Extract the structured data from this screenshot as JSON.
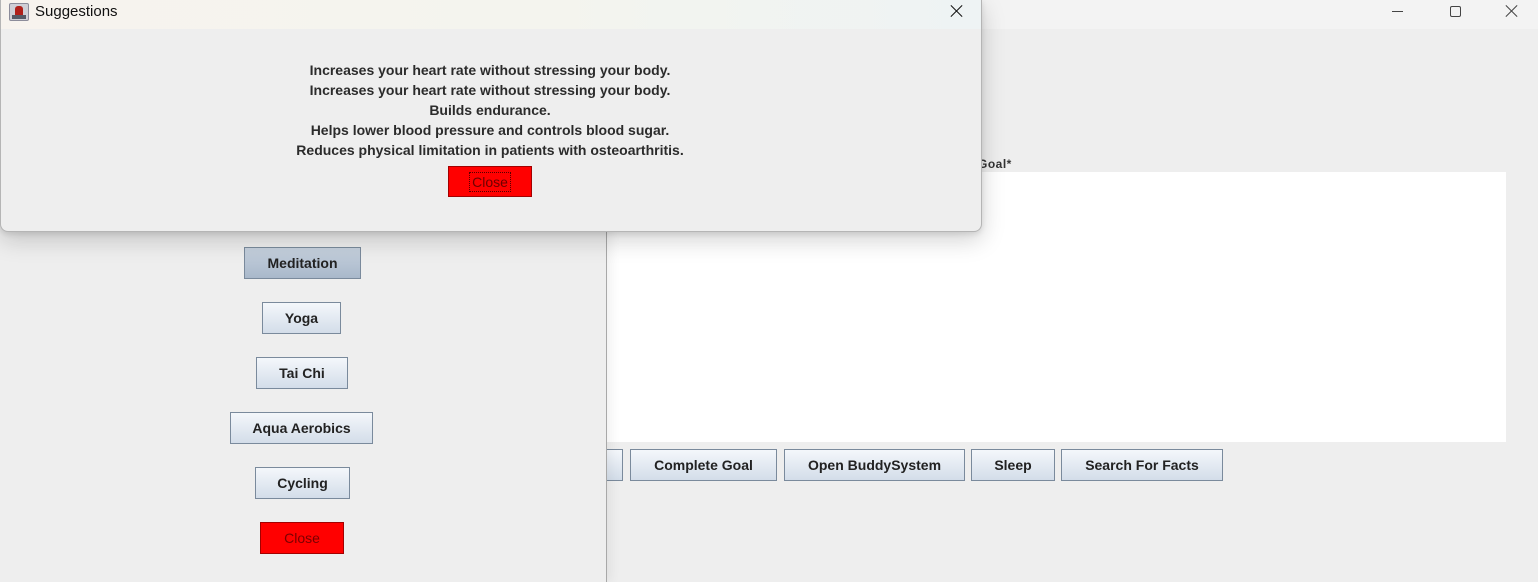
{
  "main_window": {
    "goal_label": "Goal*",
    "buttons": {
      "complete_goal": "Complete Goal",
      "open_buddy_system": "Open BuddySystem",
      "sleep": "Sleep",
      "search_for_facts": "Search For Facts"
    }
  },
  "activities_panel": {
    "buttons": [
      "Meditation",
      "Yoga",
      "Tai Chi",
      "Aqua Aerobics",
      "Cycling"
    ],
    "close_label": "Close"
  },
  "dialog": {
    "title": "Suggestions",
    "lines": [
      "Increases your heart rate without stressing your body.",
      "Increases your heart rate without stressing your body.",
      "Builds endurance.",
      "Helps lower blood pressure and controls blood sugar.",
      "Reduces physical limitation in patients with osteoarthritis."
    ],
    "close_label": "Close"
  },
  "colors": {
    "close_button": "#ff0000",
    "background": "#eeeeee",
    "text_area": "#ffffff"
  },
  "icons": [
    "app-icon",
    "minimize-icon",
    "maximize-icon",
    "close-icon"
  ]
}
